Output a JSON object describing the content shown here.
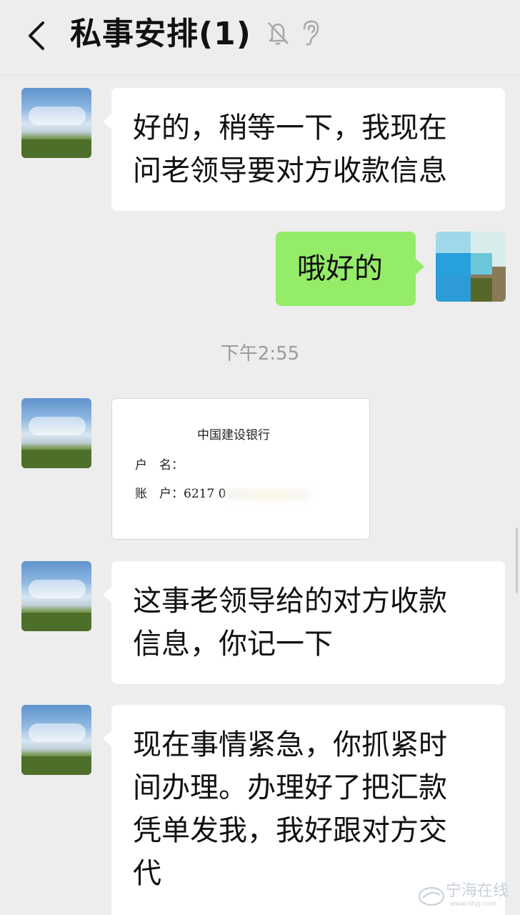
{
  "header": {
    "title": "私事安排(1)"
  },
  "messages": [
    {
      "side": "left",
      "type": "text",
      "lines": [
        "好的，稍等一下，我现在",
        "问老领导要对方收款信息"
      ]
    },
    {
      "side": "right",
      "type": "text",
      "lines": [
        "哦好的"
      ]
    },
    {
      "type": "time",
      "text": "下午2:55"
    },
    {
      "side": "left",
      "type": "image",
      "bank": "中国建设银行",
      "name_label": "户　名：",
      "account_label": "账　户：6217 0"
    },
    {
      "side": "left",
      "type": "text",
      "lines": [
        "这事老领导给的对方收款",
        "信息，你记一下"
      ]
    },
    {
      "side": "left",
      "type": "text",
      "lines": [
        "现在事情紧急，你抓紧时",
        "间办理。办理好了把汇款",
        "凭单发我，我好跟对方交",
        "代"
      ]
    }
  ],
  "watermark": {
    "text": "宁海在线",
    "sub": "www.nhzj.com"
  },
  "colors": {
    "background": "#ededed",
    "self_bubble": "#95ec69",
    "other_bubble": "#ffffff",
    "timestamp": "#9b9b9b"
  }
}
